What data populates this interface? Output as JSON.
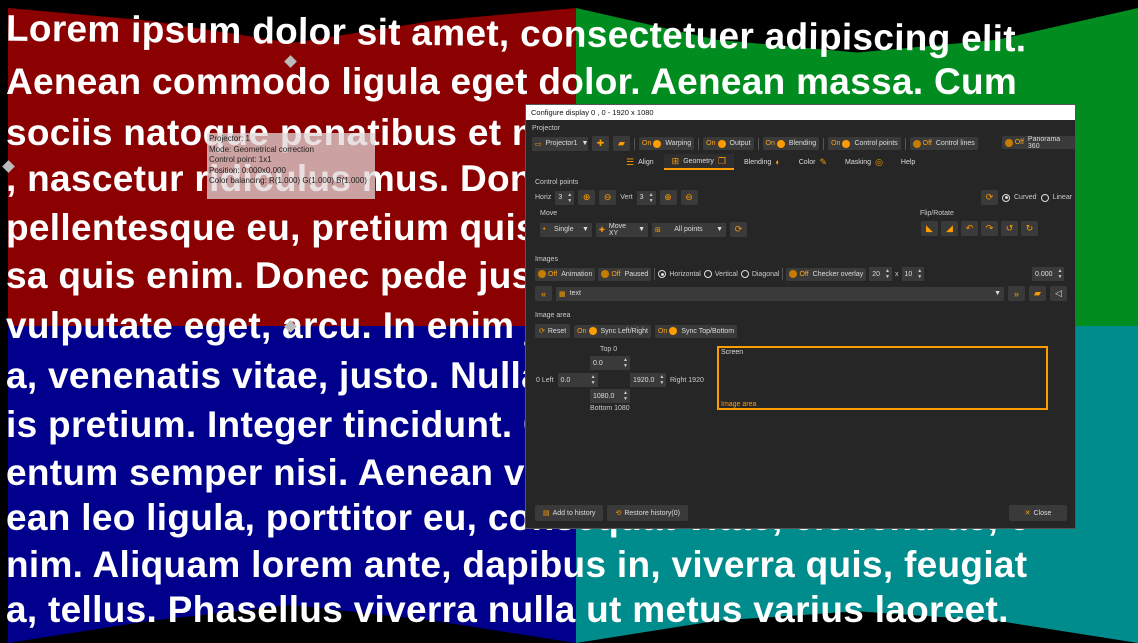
{
  "background": {
    "lines": [
      "Lorem ipsum dolor sit amet, consectetuer adipiscing elit.",
      "Aenean commodo ligula eget dolor. Aenean massa. Cum",
      "sociis natoque penatibus et magnis dis parturient montes",
      ", nascetur ridiculus mus. Donec quam felis, ultricies nec,",
      "pellentesque eu, pretium quis, sem. Nulla consequat massa",
      "sa quis enim. Donec pede justo, fringilla vel, aliquet nec,",
      "vulputate eget, arcu. In enim justo, rhoncus ut, imperdiet",
      "a, venenatis vitae, justo. Nullam dictum felis eu pede moll",
      "is pretium. Integer tincidunt. Cras dapibus. Vivamus elem",
      "entum semper nisi. Aenean vulputate eleifend tellus. Aen",
      "ean leo ligula, porttitor eu, consequat vitae, eleifend ac, e",
      "nim. Aliquam lorem ante, dapibus in, viverra quis, feugiat",
      "a, tellus. Phasellus viverra nulla ut metus varius laoreet."
    ],
    "colors": {
      "red": "#8b0000",
      "green": "#008c1e",
      "blue": "#00008c",
      "teal": "#008c8c"
    }
  },
  "info_overlay": {
    "projector": "Projector: 1",
    "mode": "Mode: Geometrical correction",
    "control_point": "Control point: 1x1",
    "position": "Position: 0.000x0.000",
    "color_balancing": "Color balancing: R(1.000) G(1.000) B(1.000)"
  },
  "dialog": {
    "title": "Configure display 0 , 0 - 1920 x 1080",
    "projector_section": "Projector",
    "projector_select": "Projector1",
    "toggles": [
      {
        "state": "On",
        "label": "Warping"
      },
      {
        "state": "On",
        "label": "Output"
      },
      {
        "state": "On",
        "label": "Blending"
      },
      {
        "state": "On",
        "label": "Control points"
      },
      {
        "state": "Off",
        "label": "Control lines"
      }
    ],
    "panorama": {
      "state": "Off",
      "label": "Panorama 360"
    },
    "tabs": [
      {
        "label": "Align",
        "icon": "align-icon"
      },
      {
        "label": "Geometry",
        "icon": "grid-icon"
      },
      {
        "label": "Blending",
        "icon": "blend-icon"
      },
      {
        "label": "Color",
        "icon": "color-icon"
      },
      {
        "label": "Masking",
        "icon": "mask-icon"
      },
      {
        "label": "Help",
        "icon": "help-icon"
      }
    ],
    "active_tab": "Geometry",
    "control_points": {
      "section": "Control points",
      "horiz_label": "Horiz",
      "horiz_value": "3",
      "vert_label": "Vert",
      "vert_value": "3",
      "curved_label": "Curved",
      "linear_label": "Linear",
      "selected_mode": "Curved"
    },
    "move": {
      "section": "Move",
      "single": "Single",
      "move_xy": "Move XY",
      "all_points": "All points"
    },
    "flip_rotate": {
      "section": "Flip/Rotate"
    },
    "images": {
      "section": "Images",
      "animation": {
        "state": "Off",
        "label": "Animation"
      },
      "paused": {
        "state": "Off",
        "label": "Paused"
      },
      "horizontal": "Horizontal",
      "vertical": "Vertical",
      "diagonal": "Diagonal",
      "selected_direction": "Horizontal",
      "checker": {
        "state": "Off",
        "label": "Checker overlay"
      },
      "checker_x": "20",
      "checker_sep": "x",
      "checker_y": "10",
      "right_value": "0.000",
      "image_name": "text"
    },
    "image_area": {
      "section": "Image area",
      "reset": "Reset",
      "sync_lr": {
        "state": "On",
        "label": "Sync Left/Right"
      },
      "sync_tb": {
        "state": "On",
        "label": "Sync Top/Bottom"
      },
      "top_label": "Top 0",
      "top_value": "0.0",
      "left_label": "0 Left",
      "left_value": "0.0",
      "right_value": "1920.0",
      "right_label": "Right 1920",
      "bottom_value": "1080.0",
      "bottom_label": "Bottom 1080",
      "screen_label": "Screen",
      "image_area_label": "Image area"
    },
    "footer": {
      "add_history": "Add to history",
      "restore_history": "Restore history(0)",
      "close": "Close"
    },
    "accent": "#ff9c00"
  }
}
